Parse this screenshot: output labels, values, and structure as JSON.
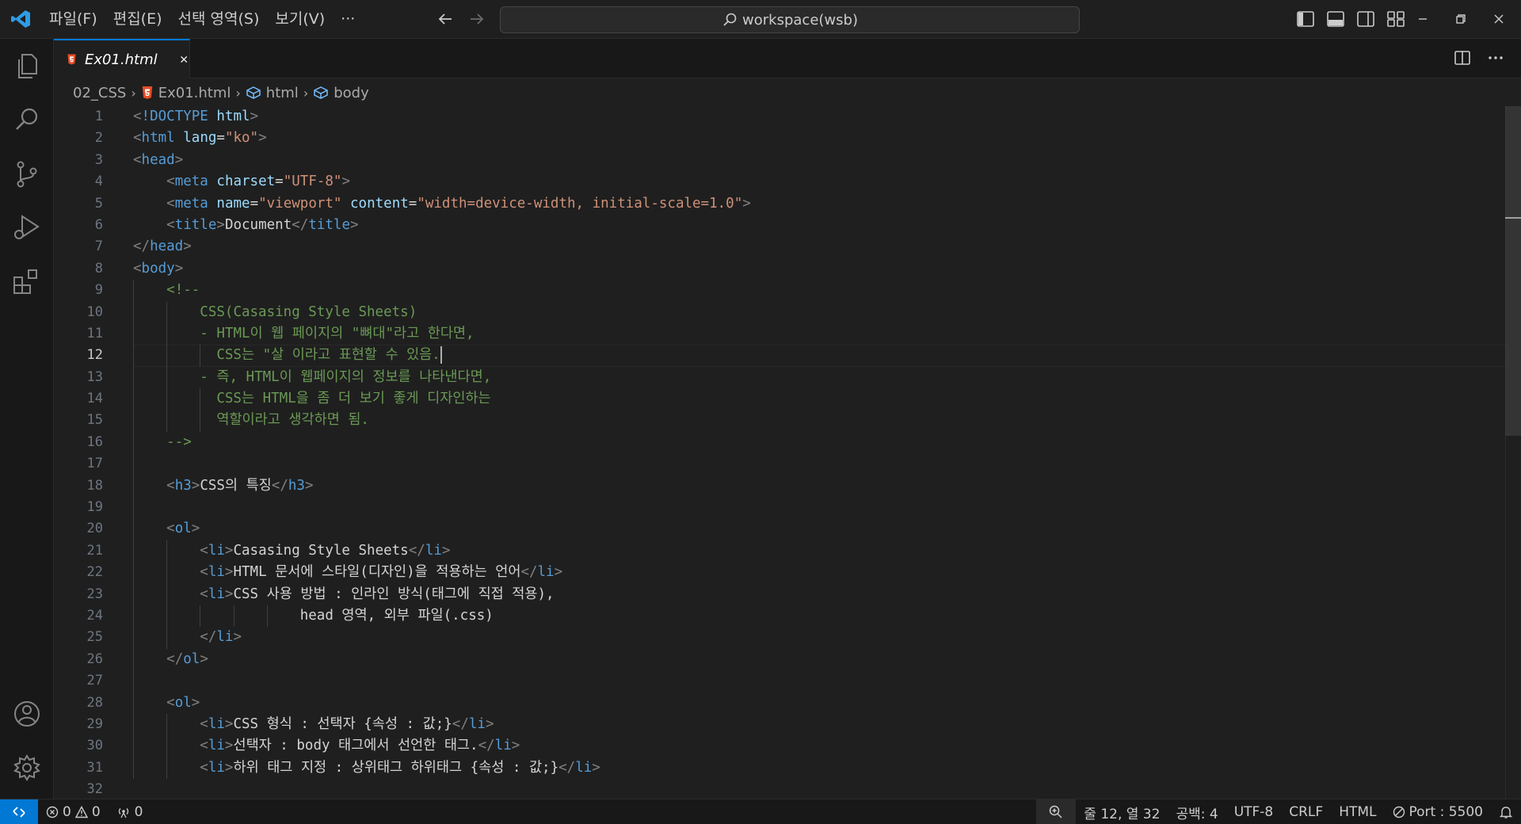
{
  "menu": [
    "파일(F)",
    "편집(E)",
    "선택 영역(S)",
    "보기(V)",
    "···"
  ],
  "search": {
    "label": "workspace(wsb)"
  },
  "tab": {
    "label": "Ex01.html"
  },
  "breadcrumb": {
    "folder": "02_CSS",
    "file": "Ex01.html",
    "sym1": "html",
    "sym2": "body"
  },
  "editor": {
    "active_line": 12,
    "line_numbers": [
      "1",
      "2",
      "3",
      "4",
      "5",
      "6",
      "7",
      "8",
      "9",
      "10",
      "11",
      "12",
      "13",
      "14",
      "15",
      "16",
      "17",
      "18",
      "19",
      "20",
      "21",
      "22",
      "23",
      "24",
      "25",
      "26",
      "27",
      "28",
      "29",
      "30",
      "31",
      "32"
    ],
    "lines": [
      [
        [
          "punc",
          "<"
        ],
        [
          "tag",
          "!DOCTYPE"
        ],
        [
          "txt",
          " "
        ],
        [
          "attr",
          "html"
        ],
        [
          "punc",
          ">"
        ]
      ],
      [
        [
          "punc",
          "<"
        ],
        [
          "tag",
          "html"
        ],
        [
          "txt",
          " "
        ],
        [
          "attr",
          "lang"
        ],
        [
          "txt",
          "="
        ],
        [
          "str",
          "\"ko\""
        ],
        [
          "punc",
          ">"
        ]
      ],
      [
        [
          "punc",
          "<"
        ],
        [
          "tag",
          "head"
        ],
        [
          "punc",
          ">"
        ]
      ],
      [
        [
          "txt",
          "    "
        ],
        [
          "punc",
          "<"
        ],
        [
          "tag",
          "meta"
        ],
        [
          "txt",
          " "
        ],
        [
          "attr",
          "charset"
        ],
        [
          "txt",
          "="
        ],
        [
          "str",
          "\"UTF-8\""
        ],
        [
          "punc",
          ">"
        ]
      ],
      [
        [
          "txt",
          "    "
        ],
        [
          "punc",
          "<"
        ],
        [
          "tag",
          "meta"
        ],
        [
          "txt",
          " "
        ],
        [
          "attr",
          "name"
        ],
        [
          "txt",
          "="
        ],
        [
          "str",
          "\"viewport\""
        ],
        [
          "txt",
          " "
        ],
        [
          "attr",
          "content"
        ],
        [
          "txt",
          "="
        ],
        [
          "str",
          "\"width=device-width, initial-scale=1.0\""
        ],
        [
          "punc",
          ">"
        ]
      ],
      [
        [
          "txt",
          "    "
        ],
        [
          "punc",
          "<"
        ],
        [
          "tag",
          "title"
        ],
        [
          "punc",
          ">"
        ],
        [
          "txt",
          "Document"
        ],
        [
          "punc",
          "</"
        ],
        [
          "tag",
          "title"
        ],
        [
          "punc",
          ">"
        ]
      ],
      [
        [
          "punc",
          "</"
        ],
        [
          "tag",
          "head"
        ],
        [
          "punc",
          ">"
        ]
      ],
      [
        [
          "punc",
          "<"
        ],
        [
          "tag",
          "body"
        ],
        [
          "punc",
          ">"
        ]
      ],
      [
        [
          "txt",
          "    "
        ],
        [
          "cmt",
          "<!--"
        ]
      ],
      [
        [
          "txt",
          "        "
        ],
        [
          "cmt",
          "CSS(Casasing Style Sheets)"
        ]
      ],
      [
        [
          "txt",
          "        "
        ],
        [
          "cmt",
          "- HTML이 웹 페이지의 \"뼈대\"라고 한다면,"
        ]
      ],
      [
        [
          "txt",
          "          "
        ],
        [
          "cmt",
          "CSS는 \"살 이라고 표현할 수 있음."
        ],
        [
          "cursor",
          ""
        ]
      ],
      [
        [
          "txt",
          "        "
        ],
        [
          "cmt",
          "- 즉, HTML이 웹페이지의 정보를 나타낸다면,"
        ]
      ],
      [
        [
          "txt",
          "          "
        ],
        [
          "cmt",
          "CSS는 HTML을 좀 더 보기 좋게 디자인하는"
        ]
      ],
      [
        [
          "txt",
          "          "
        ],
        [
          "cmt",
          "역할이라고 생각하면 됨."
        ]
      ],
      [
        [
          "txt",
          "    "
        ],
        [
          "cmt",
          "-->"
        ]
      ],
      [],
      [
        [
          "txt",
          "    "
        ],
        [
          "punc",
          "<"
        ],
        [
          "tag",
          "h3"
        ],
        [
          "punc",
          ">"
        ],
        [
          "txt",
          "CSS의 특징"
        ],
        [
          "punc",
          "</"
        ],
        [
          "tag",
          "h3"
        ],
        [
          "punc",
          ">"
        ]
      ],
      [],
      [
        [
          "txt",
          "    "
        ],
        [
          "punc",
          "<"
        ],
        [
          "tag",
          "ol"
        ],
        [
          "punc",
          ">"
        ]
      ],
      [
        [
          "txt",
          "        "
        ],
        [
          "punc",
          "<"
        ],
        [
          "tag",
          "li"
        ],
        [
          "punc",
          ">"
        ],
        [
          "txt",
          "Casasing Style Sheets"
        ],
        [
          "punc",
          "</"
        ],
        [
          "tag",
          "li"
        ],
        [
          "punc",
          ">"
        ]
      ],
      [
        [
          "txt",
          "        "
        ],
        [
          "punc",
          "<"
        ],
        [
          "tag",
          "li"
        ],
        [
          "punc",
          ">"
        ],
        [
          "txt",
          "HTML 문서에 스타일(디자인)을 적용하는 언어"
        ],
        [
          "punc",
          "</"
        ],
        [
          "tag",
          "li"
        ],
        [
          "punc",
          ">"
        ]
      ],
      [
        [
          "txt",
          "        "
        ],
        [
          "punc",
          "<"
        ],
        [
          "tag",
          "li"
        ],
        [
          "punc",
          ">"
        ],
        [
          "txt",
          "CSS 사용 방법 : 인라인 방식(태그에 직접 적용),"
        ]
      ],
      [
        [
          "txt",
          "                    head 영역, 외부 파일(.css)"
        ]
      ],
      [
        [
          "txt",
          "        "
        ],
        [
          "punc",
          "</"
        ],
        [
          "tag",
          "li"
        ],
        [
          "punc",
          ">"
        ]
      ],
      [
        [
          "txt",
          "    "
        ],
        [
          "punc",
          "</"
        ],
        [
          "tag",
          "ol"
        ],
        [
          "punc",
          ">"
        ]
      ],
      [],
      [
        [
          "txt",
          "    "
        ],
        [
          "punc",
          "<"
        ],
        [
          "tag",
          "ol"
        ],
        [
          "punc",
          ">"
        ]
      ],
      [
        [
          "txt",
          "        "
        ],
        [
          "punc",
          "<"
        ],
        [
          "tag",
          "li"
        ],
        [
          "punc",
          ">"
        ],
        [
          "txt",
          "CSS 형식 : 선택자 {속성 : 값;}"
        ],
        [
          "punc",
          "</"
        ],
        [
          "tag",
          "li"
        ],
        [
          "punc",
          ">"
        ]
      ],
      [
        [
          "txt",
          "        "
        ],
        [
          "punc",
          "<"
        ],
        [
          "tag",
          "li"
        ],
        [
          "punc",
          ">"
        ],
        [
          "txt",
          "선택자 : body 태그에서 선언한 태그."
        ],
        [
          "punc",
          "</"
        ],
        [
          "tag",
          "li"
        ],
        [
          "punc",
          ">"
        ]
      ],
      [
        [
          "txt",
          "        "
        ],
        [
          "punc",
          "<"
        ],
        [
          "tag",
          "li"
        ],
        [
          "punc",
          ">"
        ],
        [
          "txt",
          "하위 태그 지정 : 상위태그 하위태그 {속성 : 값;}"
        ],
        [
          "punc",
          "</"
        ],
        [
          "tag",
          "li"
        ],
        [
          "punc",
          ">"
        ]
      ],
      []
    ]
  },
  "status": {
    "errors": "0",
    "warnings": "0",
    "ports": "0",
    "position": "줄 12, 열 32",
    "spaces": "공백: 4",
    "encoding": "UTF-8",
    "eol": "CRLF",
    "language": "HTML",
    "port": "Port : 5500"
  },
  "colors": {
    "accent": "#0078d4",
    "html_icon": "#e44d26",
    "comment": "#6a9955",
    "tag": "#569cd6",
    "string": "#ce9178",
    "attr": "#9cdcfe"
  }
}
